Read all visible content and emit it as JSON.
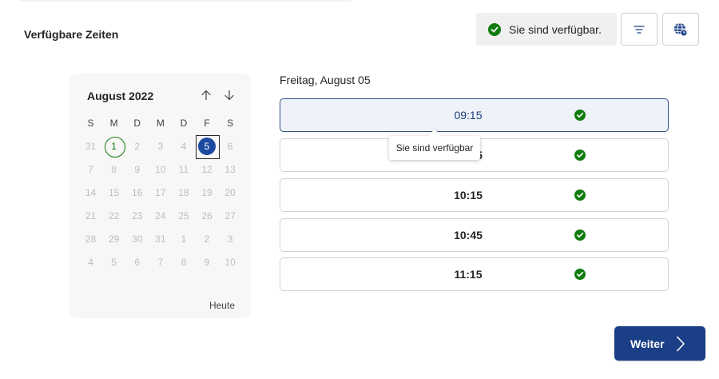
{
  "page": {
    "section_title": "Verfügbare Zeiten"
  },
  "status": {
    "text": "Sie sind verfügbar.",
    "icon": "check-circle-icon",
    "color": "#107c10"
  },
  "toolbar": {
    "filter_icon": "filter-icon",
    "timezone_icon": "globe-clock-icon"
  },
  "calendar": {
    "month_title": "August 2022",
    "weekdays": [
      "S",
      "M",
      "D",
      "M",
      "D",
      "F",
      "S"
    ],
    "weeks": [
      [
        "31",
        "1",
        "2",
        "3",
        "4",
        "5",
        "6"
      ],
      [
        "7",
        "8",
        "9",
        "10",
        "11",
        "12",
        "13"
      ],
      [
        "14",
        "15",
        "16",
        "17",
        "18",
        "19",
        "20"
      ],
      [
        "21",
        "22",
        "23",
        "24",
        "25",
        "26",
        "27"
      ],
      [
        "28",
        "29",
        "30",
        "31",
        "1",
        "2",
        "3"
      ],
      [
        "4",
        "5",
        "6",
        "7",
        "8",
        "9",
        "10"
      ]
    ],
    "today": "1",
    "selected": "5",
    "today_link": "Heute",
    "selected_color": "#1b4aa0"
  },
  "slots": {
    "date_heading": "Freitag, August 05",
    "items": [
      {
        "time": "09:15",
        "available": true,
        "active": true
      },
      {
        "time": "09:45",
        "available": true,
        "active": false
      },
      {
        "time": "10:15",
        "available": true,
        "active": false
      },
      {
        "time": "10:45",
        "available": true,
        "active": false
      },
      {
        "time": "11:15",
        "available": true,
        "active": false
      }
    ]
  },
  "tooltip": {
    "text": "Sie sind verfügbar"
  },
  "actions": {
    "next_label": "Weiter",
    "next_color": "#1b3f87"
  }
}
